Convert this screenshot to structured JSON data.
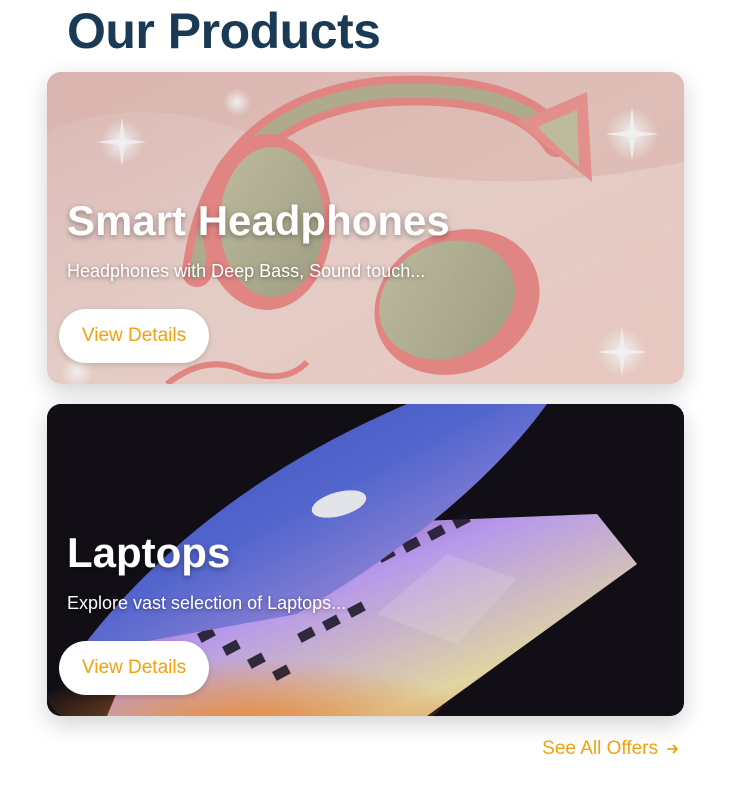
{
  "page": {
    "heading": "Our Products"
  },
  "products": [
    {
      "title": "Smart Headphones",
      "description": "Headphones with Deep Bass, Sound touch...",
      "button_label": "View Details",
      "image": "pink-headphones-photo"
    },
    {
      "title": "Laptops",
      "description": "Explore vast selection of Laptops...",
      "button_label": "View Details",
      "image": "glowing-laptop-photo"
    }
  ],
  "footer": {
    "see_all_label": "See All Offers",
    "see_all_icon": "arrow-right-icon"
  },
  "colors": {
    "heading": "#1a3a55",
    "accent": "#f2a10c",
    "card_text": "#ffffff"
  }
}
